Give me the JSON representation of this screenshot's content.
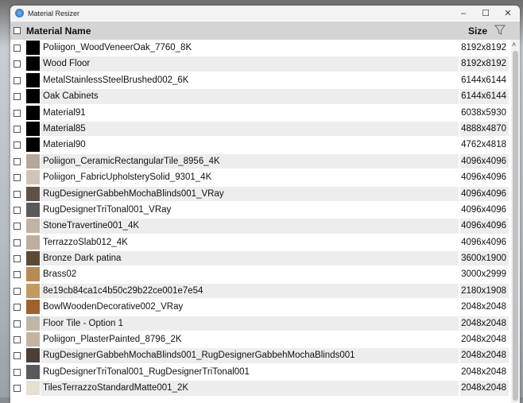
{
  "window": {
    "title": "Material Resizer",
    "minimize": "–",
    "maximize": "☐",
    "close": "✕"
  },
  "header": {
    "name": "Material Name",
    "size": "Size"
  },
  "rows": [
    {
      "name": "Poliigon_WoodVeneerOak_7760_8K",
      "size": "8192x8192",
      "swatch": "#000000"
    },
    {
      "name": "Wood Floor",
      "size": "8192x8192",
      "swatch": "#000000"
    },
    {
      "name": "MetalStainlessSteelBrushed002_6K",
      "size": "6144x6144",
      "swatch": "#000000"
    },
    {
      "name": "Oak Cabinets",
      "size": "6144x6144",
      "swatch": "#000000"
    },
    {
      "name": "Material91",
      "size": "6038x5930",
      "swatch": "#000000"
    },
    {
      "name": "Material85",
      "size": "4888x4870",
      "swatch": "#000000"
    },
    {
      "name": "Material90",
      "size": "4762x4818",
      "swatch": "#000000"
    },
    {
      "name": "Poliigon_CeramicRectangularTile_8956_4K",
      "size": "4096x4096",
      "swatch": "#b4a89b"
    },
    {
      "name": "Poliigon_FabricUpholsterySolid_9301_4K",
      "size": "4096x4096",
      "swatch": "#cfc4ba"
    },
    {
      "name": "RugDesignerGabbehMochaBlinds001_VRay",
      "size": "4096x4096",
      "swatch": "#5e5246"
    },
    {
      "name": "RugDesignerTriTonal001_VRay",
      "size": "4096x4096",
      "swatch": "#5a5a5a"
    },
    {
      "name": "StoneTravertine001_4K",
      "size": "4096x4096",
      "swatch": "#c2b4a4"
    },
    {
      "name": "TerrazzoSlab012_4K",
      "size": "4096x4096",
      "swatch": "#bcaf9f"
    },
    {
      "name": "Bronze Dark patina",
      "size": "3600x1900",
      "swatch": "#5c4a35"
    },
    {
      "name": "Brass02",
      "size": "3000x2999",
      "swatch": "#b58a55"
    },
    {
      "name": "8e19cb84ca1c4b50c29b22ce001e7e54",
      "size": "2180x1908",
      "swatch": "#c49a62"
    },
    {
      "name": "BowlWoodenDecorative002_VRay",
      "size": "2048x2048",
      "swatch": "#a0622c"
    },
    {
      "name": "Floor Tile - Option 1",
      "size": "2048x2048",
      "swatch": "#bdb7a6"
    },
    {
      "name": "Poliigon_PlasterPainted_8796_2K",
      "size": "2048x2048",
      "swatch": "#c4b3a3"
    },
    {
      "name": "RugDesignerGabbehMochaBlinds001_RugDesignerGabbehMochaBlinds001",
      "size": "2048x2048",
      "swatch": "#4a4038"
    },
    {
      "name": "RugDesignerTriTonal001_RugDesignerTriTonal001",
      "size": "2048x2048",
      "swatch": "#5a5a5a"
    },
    {
      "name": "TilesTerrazzoStandardMatte001_2K",
      "size": "2048x2048",
      "swatch": "#e6e0d4"
    }
  ]
}
